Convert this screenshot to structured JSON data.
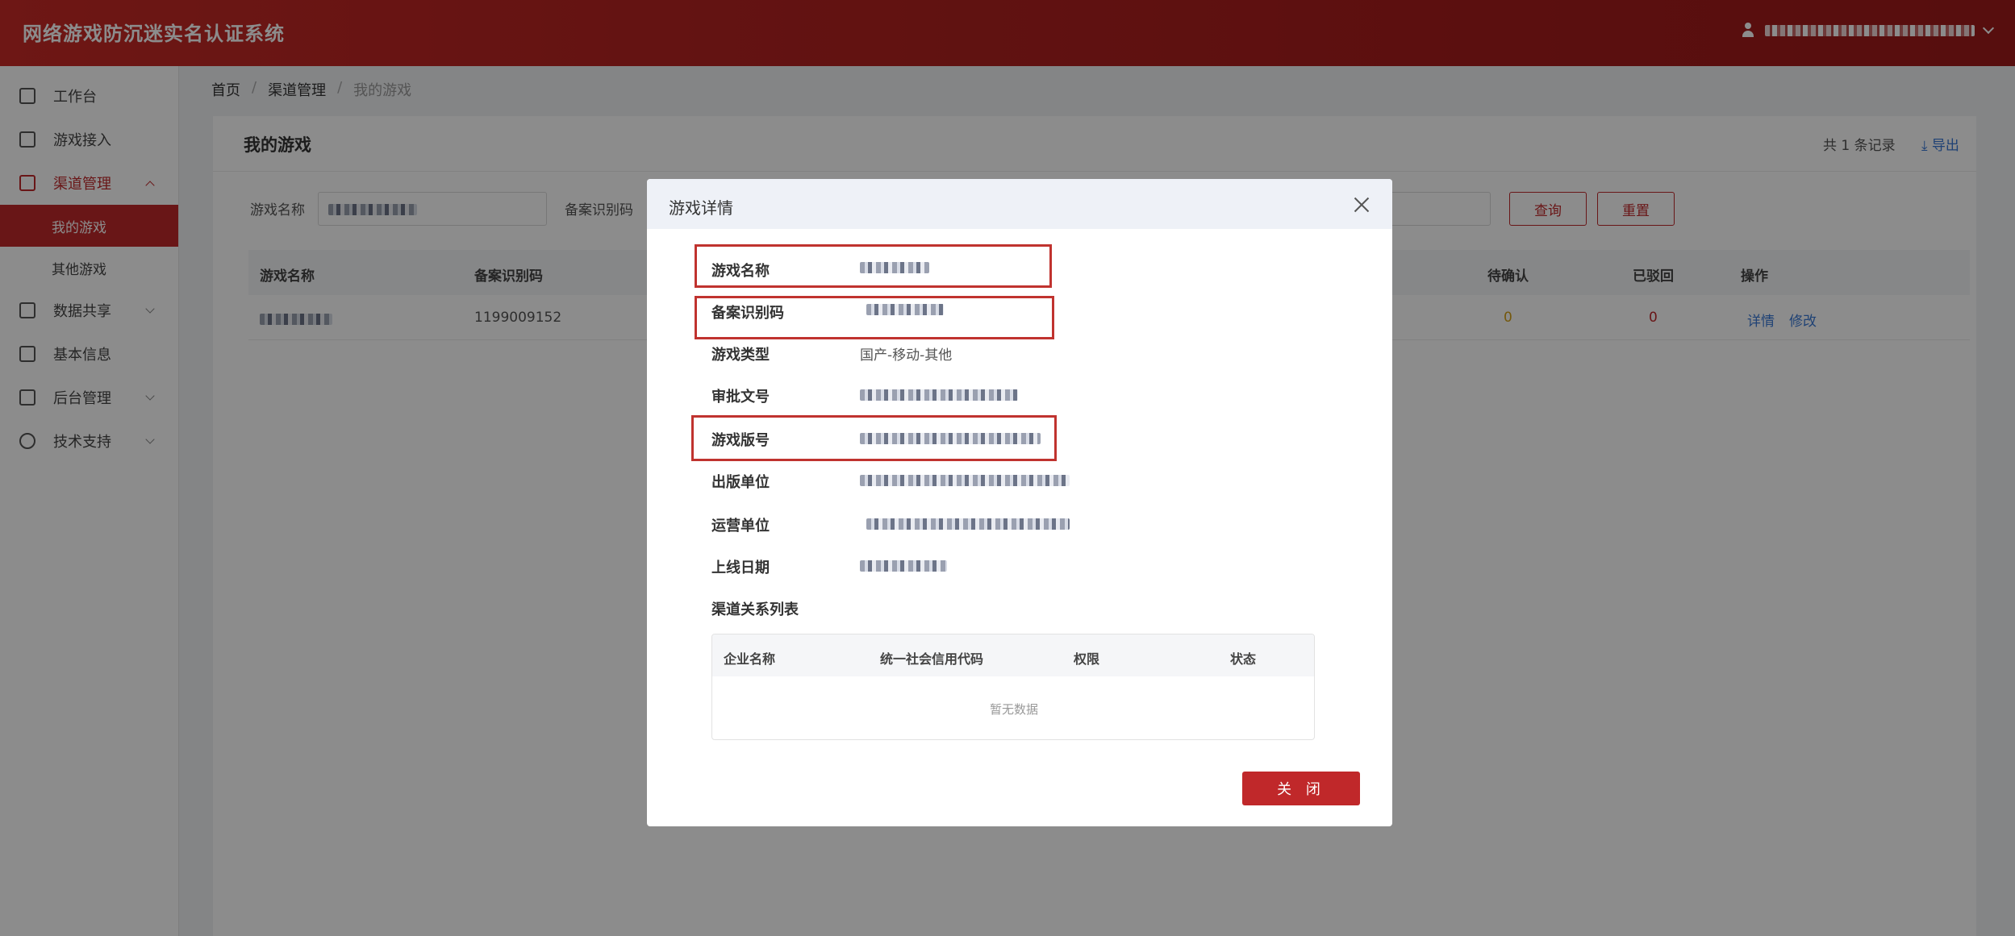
{
  "header": {
    "title": "网络游戏防沉迷实名认证系统",
    "user_icon": "user-icon"
  },
  "sidebar": {
    "items": [
      {
        "label": "工作台",
        "icon": "home-icon"
      },
      {
        "label": "游戏接入",
        "icon": "document-icon"
      },
      {
        "label": "渠道管理",
        "icon": "org-chart-icon",
        "expanded": true,
        "children": [
          {
            "label": "我的游戏",
            "active": true
          },
          {
            "label": "其他游戏"
          }
        ]
      },
      {
        "label": "数据共享",
        "icon": "share-icon"
      },
      {
        "label": "基本信息",
        "icon": "info-card-icon"
      },
      {
        "label": "后台管理",
        "icon": "sliders-icon"
      },
      {
        "label": "技术支持",
        "icon": "support-icon"
      }
    ]
  },
  "breadcrumb": {
    "home": "首页",
    "section": "渠道管理",
    "current": "我的游戏",
    "separator": "/"
  },
  "main": {
    "title": "我的游戏",
    "total": "共 1 条记录",
    "export": "导出",
    "filters": {
      "name_label": "游戏名称",
      "code_label": "备案识别码",
      "query": "查询",
      "reset": "重置"
    },
    "table": {
      "headers": [
        "游戏名称",
        "备案识别码",
        "待确认",
        "已驳回",
        "操作"
      ],
      "rows": [
        {
          "code": "1199009152",
          "pending": "0",
          "rejected": "0",
          "action_detail": "详情",
          "action_edit": "修改"
        }
      ]
    }
  },
  "modal": {
    "title": "游戏详情",
    "fields": {
      "name": "游戏名称",
      "code": "备案识别码",
      "type": "游戏类型",
      "type_value": "国产-移动-其他",
      "approval": "审批文号",
      "version": "游戏版号",
      "publisher": "出版单位",
      "operator": "运营单位",
      "launch_date": "上线日期"
    },
    "channel_list": {
      "title": "渠道关系列表",
      "headers": [
        "企业名称",
        "统一社会信用代码",
        "权限",
        "状态"
      ],
      "empty": "暂无数据"
    },
    "close_button": "关 闭",
    "highlight_color": "#c0332f"
  },
  "colors": {
    "brand": "#c0282a",
    "link": "#3a78d6",
    "pending": "#d4a017"
  }
}
